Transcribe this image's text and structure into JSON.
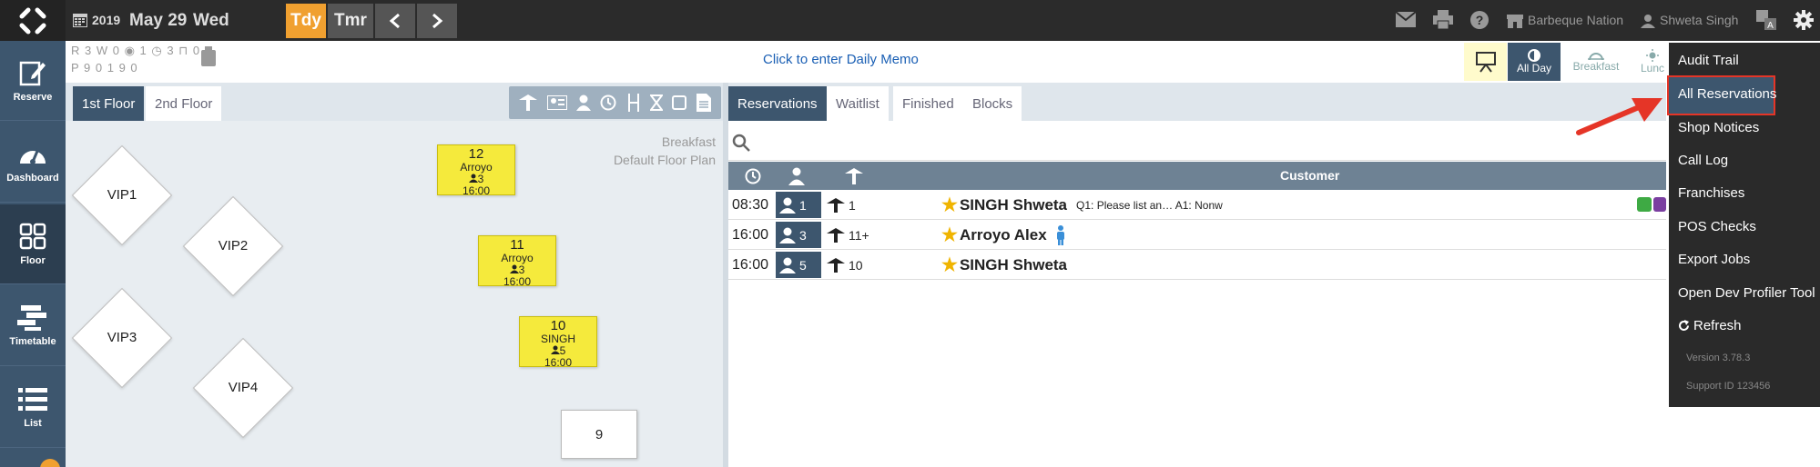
{
  "topbar": {
    "year": "2019",
    "date": "May 29",
    "weekday": "Wed",
    "today_label": "Tdy",
    "tomorrow_label": "Tmr",
    "restaurant": "Barbeque Nation",
    "user": "Shweta Singh"
  },
  "sidebar": {
    "items": [
      {
        "label": "Reserve",
        "icon": "edit-icon"
      },
      {
        "label": "Dashboard",
        "icon": "gauge-icon"
      },
      {
        "label": "Floor",
        "icon": "grid-icon"
      },
      {
        "label": "Timetable",
        "icon": "timetable-icon"
      },
      {
        "label": "List",
        "icon": "list-icon"
      }
    ]
  },
  "counts": {
    "row1": "R 3 W 0 ◉ 1 ◷ 3 ⊓ 0",
    "row2": "P 9   0   1   9   0"
  },
  "memo": "Click to enter Daily Memo",
  "shifts": {
    "all_day": "All Day",
    "breakfast": "Breakfast",
    "lunch": "Lunc"
  },
  "floor": {
    "tabs": [
      "1st Floor",
      "2nd Floor"
    ],
    "canvas_meal": "Breakfast",
    "canvas_plan": "Default Floor Plan",
    "vip_tables": [
      "VIP1",
      "VIP2",
      "VIP3",
      "VIP4"
    ],
    "booked_tables": [
      {
        "num": "12",
        "name": "Arroyo",
        "covers": "3",
        "time": "16:00"
      },
      {
        "num": "11",
        "name": "Arroyo",
        "covers": "3",
        "time": "16:00"
      },
      {
        "num": "10",
        "name": "SINGH",
        "covers": "5",
        "time": "16:00"
      }
    ],
    "free_table": "9"
  },
  "reservations": {
    "tabs": [
      "Reservations",
      "Waitlist",
      "Finished",
      "Blocks"
    ],
    "header_customer": "Customer",
    "rows": [
      {
        "time": "08:30",
        "covers": "1",
        "table": "1",
        "customer": "SINGH Shweta",
        "note": "Q1: Please list an… A1: Nonw"
      },
      {
        "time": "16:00",
        "covers": "3",
        "table": "11+",
        "customer": "Arroyo Alex",
        "note": ""
      },
      {
        "time": "16:00",
        "covers": "5",
        "table": "10",
        "customer": "SINGH Shweta",
        "note": ""
      }
    ]
  },
  "menu": {
    "items": [
      "Audit Trail",
      "All Reservations",
      "Shop Notices",
      "Call Log",
      "Franchises",
      "POS Checks",
      "Export Jobs",
      "Open Dev Profiler Tool",
      "Refresh"
    ],
    "version": "Version 3.78.3",
    "support": "Support ID 123456"
  },
  "colors": {
    "accent": "#3d566e",
    "today": "#f0a030",
    "booked_table": "#f5ea3c",
    "highlight_border": "#e53527"
  }
}
